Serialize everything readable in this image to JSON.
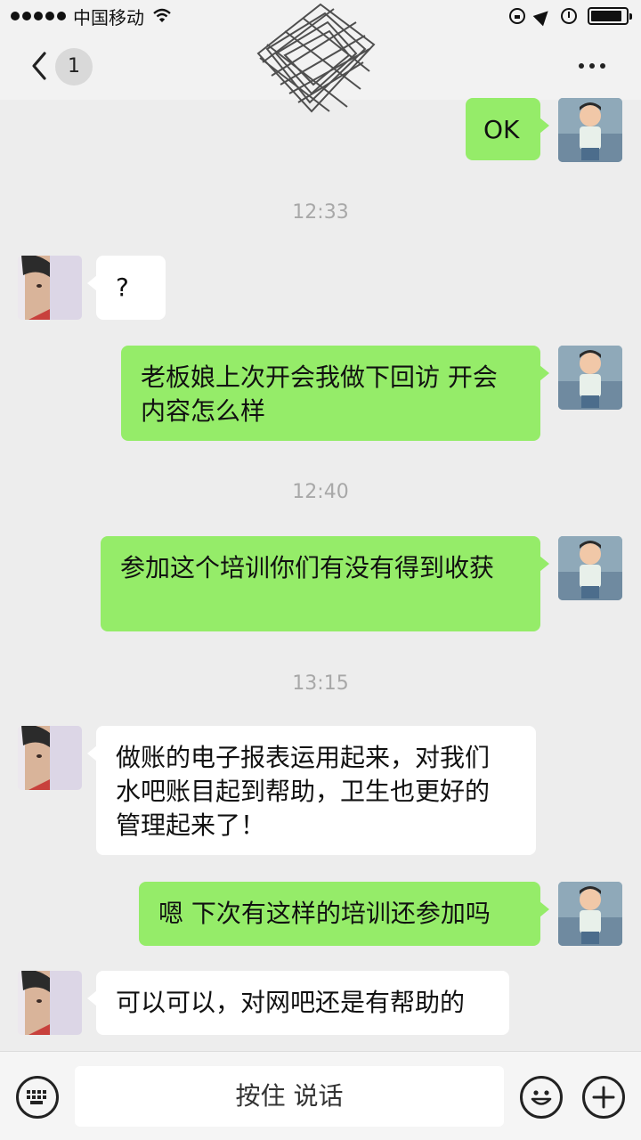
{
  "status_bar": {
    "carrier": "中国移动",
    "signal_dots": 5,
    "battery_level": 0.9
  },
  "nav": {
    "unread_count": "1"
  },
  "messages": [
    {
      "side": "out",
      "text": "OK"
    },
    {
      "type": "time",
      "text": "12:33"
    },
    {
      "side": "in",
      "text": "?"
    },
    {
      "side": "out",
      "text": "老板娘上次开会我做下回访 开会\n内容怎么样"
    },
    {
      "type": "time",
      "text": "12:40"
    },
    {
      "side": "out",
      "text": "参加这个培训你们有没有得到收获"
    },
    {
      "type": "time",
      "text": "13:15"
    },
    {
      "side": "in",
      "text": "做账的电子报表运用起来，对我们\n水吧账目起到帮助，卫生也更好的\n管理起来了！"
    },
    {
      "side": "out",
      "text": "嗯 下次有这样的培训还参加吗"
    },
    {
      "side": "in",
      "text": "可以可以，对网吧还是有帮助的"
    }
  ],
  "input_bar": {
    "hold_to_talk_label": "按住 说话"
  }
}
